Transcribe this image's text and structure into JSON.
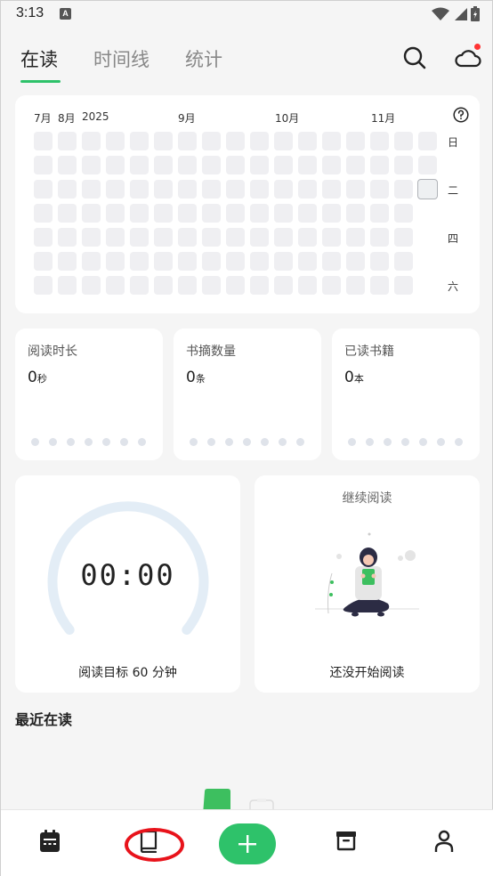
{
  "status_bar": {
    "time": "3:13",
    "notif_icon_letter": "A",
    "icons": [
      "wifi-icon",
      "signal-icon",
      "battery-icon"
    ]
  },
  "tabs": [
    {
      "label": "在读",
      "active": true
    },
    {
      "label": "时间线",
      "active": false
    },
    {
      "label": "统计",
      "active": false
    }
  ],
  "header_icons": [
    "search-icon",
    "cloud-sync-icon"
  ],
  "heatmap": {
    "months": [
      "7月",
      "8月",
      "2025",
      "9月",
      "10月",
      "11月"
    ],
    "weekdays": [
      "日",
      "二",
      "四",
      "六"
    ],
    "help_icon": "question-circle-icon"
  },
  "stats": [
    {
      "label": "阅读时长",
      "value": "0",
      "unit": "秒"
    },
    {
      "label": "书摘数量",
      "value": "0",
      "unit": "条"
    },
    {
      "label": "已读书籍",
      "value": "0",
      "unit": "本"
    }
  ],
  "timer": {
    "display": "00:00",
    "goal": "阅读目标 60 分钟",
    "progress": 0
  },
  "continue_reading": {
    "title": "继续阅读",
    "empty_text": "还没开始阅读"
  },
  "recent_section_title": "最近在读",
  "bottom_nav": [
    {
      "name": "calendar-icon"
    },
    {
      "name": "book-icon"
    },
    {
      "name": "add-icon"
    },
    {
      "name": "archive-icon"
    },
    {
      "name": "profile-icon"
    }
  ],
  "colors": {
    "accent": "#2ec26a",
    "badge": "#ff3333",
    "highlight": "#e8131b"
  }
}
